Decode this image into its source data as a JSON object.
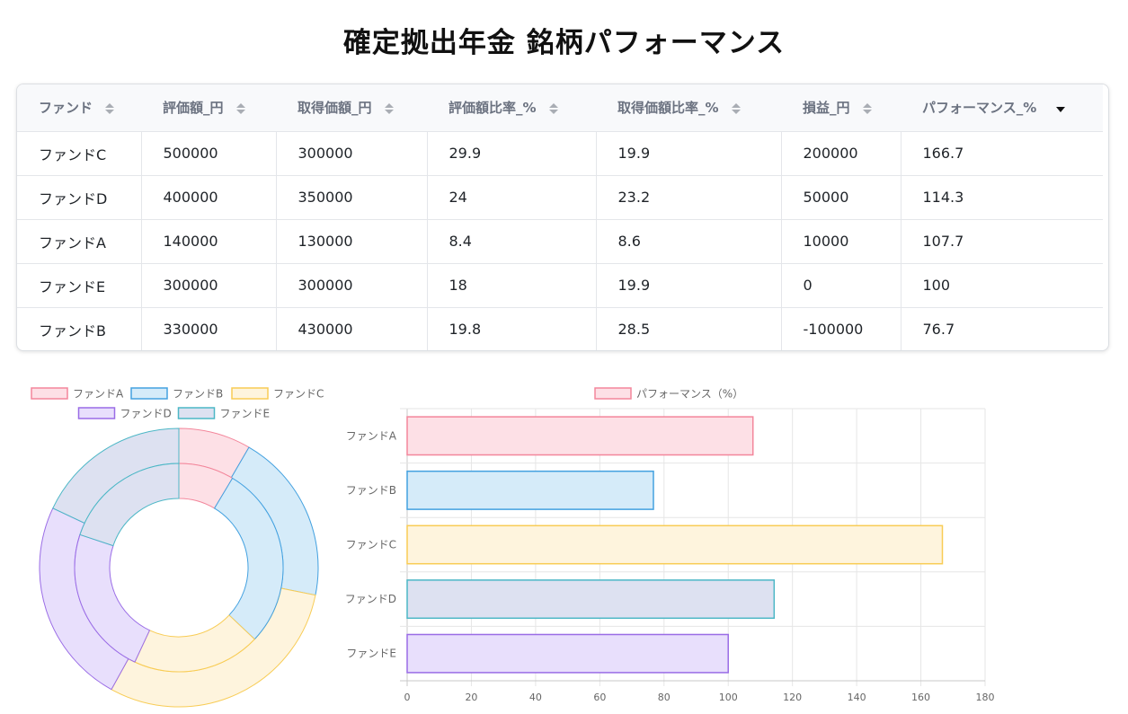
{
  "page": {
    "title": "確定拠出年金 銘柄パフォーマンス"
  },
  "table": {
    "columns": [
      "ファンド",
      "評価額_円",
      "取得価額_円",
      "評価額比率_%",
      "取得価額比率_%",
      "損益_円",
      "パフォーマンス_%"
    ],
    "sorted_column": 6,
    "sort_direction": "desc",
    "rows": [
      [
        "ファンドC",
        "500000",
        "300000",
        "29.9",
        "19.9",
        "200000",
        "166.7"
      ],
      [
        "ファンドD",
        "400000",
        "350000",
        "24",
        "23.2",
        "50000",
        "114.3"
      ],
      [
        "ファンドA",
        "140000",
        "130000",
        "8.4",
        "8.6",
        "10000",
        "107.7"
      ],
      [
        "ファンドE",
        "300000",
        "300000",
        "18",
        "19.9",
        "0",
        "100"
      ],
      [
        "ファンドB",
        "330000",
        "430000",
        "19.8",
        "28.5",
        "-100000",
        "76.7"
      ]
    ]
  },
  "chart_data": [
    {
      "type": "doughnut",
      "legend_position": "top",
      "labels": [
        "ファンドA",
        "ファンドB",
        "ファンドC",
        "ファンドD",
        "ファンドE"
      ],
      "series": [
        {
          "ring": "outer",
          "values": [
            8.4,
            19.8,
            29.9,
            24,
            18
          ]
        },
        {
          "ring": "inner",
          "values": [
            8.6,
            28.5,
            19.9,
            23.2,
            19.9
          ]
        }
      ],
      "colors": {
        "fill": [
          "#fde0e6",
          "#d5ebf9",
          "#fef4dd",
          "#e8dffc",
          "#dde1f1"
        ],
        "stroke": [
          "#f3869b",
          "#43a1e0",
          "#f8cc55",
          "#9a6ce6",
          "#4cb7c6"
        ]
      }
    },
    {
      "type": "bar",
      "orientation": "horizontal",
      "legend_position": "top",
      "series": [
        {
          "name": "パフォーマンス（%）",
          "values": [
            107.7,
            76.7,
            166.7,
            114.3,
            100
          ]
        }
      ],
      "categories": [
        "ファンドA",
        "ファンドB",
        "ファンドC",
        "ファンドD",
        "ファンドE"
      ],
      "xlim": [
        0,
        180
      ],
      "xticks": [
        0,
        20,
        40,
        60,
        80,
        100,
        120,
        140,
        160,
        180
      ],
      "grid": true,
      "colors": {
        "fill": [
          "#fde0e6",
          "#d5ebf9",
          "#fef4dd",
          "#dde1f1",
          "#e8dffc"
        ],
        "stroke": [
          "#f3869b",
          "#43a1e0",
          "#f8cc55",
          "#4cb7c6",
          "#9a6ce6"
        ]
      }
    }
  ]
}
